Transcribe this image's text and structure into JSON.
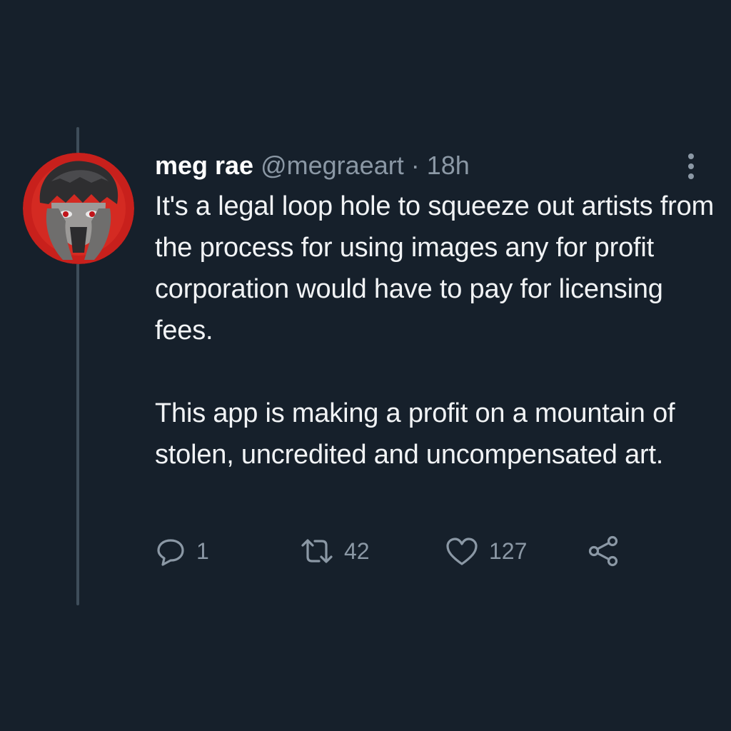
{
  "tweet": {
    "display_name": "meg rae",
    "handle": "@megraeart",
    "separator": "·",
    "time": "18h",
    "paragraphs": [
      "It's a legal loop hole to squeeze out artists from the process for using images any for profit corporation would have to pay for licensing fees.",
      "This app is making a profit on a mountain of stolen, uncredited and uncompensated art."
    ],
    "avatar_icon": "avatar-illustration",
    "more_icon": "more-vertical-icon"
  },
  "actions": {
    "reply": {
      "icon": "reply-icon",
      "count": "1"
    },
    "retweet": {
      "icon": "retweet-icon",
      "count": "42"
    },
    "like": {
      "icon": "heart-icon",
      "count": "127"
    },
    "share": {
      "icon": "share-icon"
    }
  },
  "colors": {
    "background": "#16202b",
    "text": "#f1f3f5",
    "secondary": "#8b98a5",
    "thread_line": "#3e4d5a",
    "avatar_ring": "#c8201c"
  }
}
